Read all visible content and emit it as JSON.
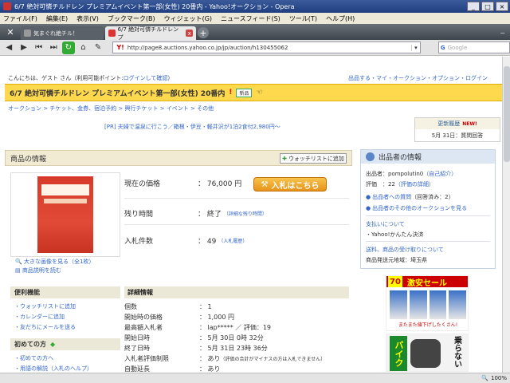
{
  "window": {
    "title": "6/7 絶対可憐チルドレン プレミアムイベント第一部(女性) 20番内 - Yahoo!オークション - Opera",
    "controls": [
      "_",
      "□",
      "×"
    ]
  },
  "menu": [
    "ファイル(F)",
    "編集(E)",
    "表示(V)",
    "ブックマーク(B)",
    "ウィジェット(G)",
    "ニュースフィード(S)",
    "ツール(T)",
    "ヘルプ(H)"
  ],
  "tabs": [
    {
      "label": "気まぐれ絶チル！"
    },
    {
      "label": "6/7 絶対可憐チルドレン プ"
    }
  ],
  "tab_close": "x",
  "new_tab": "+",
  "tabbar_right": "−",
  "address": {
    "logo": "Y!",
    "url": "http://page8.auctions.yahoo.co.jp/jp/auction/h130455062",
    "dropdown": "▾"
  },
  "search": {
    "engine": "G",
    "placeholder": "Google"
  },
  "status": {
    "zoom": "100%"
  },
  "page": {
    "greeting_prefix": "こんにちは、ゲスト さん",
    "greeting_points": "（利用可能ポイント:",
    "login_link": "ログインして確認",
    "greeting_suffix": "）",
    "top_links": "出品する・マイ・オークション・オプション・ログイン",
    "auction_title": "6/7 絶対可憐チルドレン プレミアムイベント第一部(女性) 20番内",
    "badge_new": "新品",
    "breadcrumb": "オークション > チケット、金券、宿泊予約 > 興行チケット > イベント > その他",
    "ad_link": "[PR] 夫婦で温泉に行こう／箱根・伊豆・軽井沢が1泊2食付2,980円〜",
    "history": {
      "title": "更新履歴",
      "new": "NEW!",
      "item": "5月 31日：質問回答"
    },
    "product_box": "商品の情報",
    "watch_button": "ウォッチリストに追加",
    "photo_links": [
      "大きな画像を見る（全1枚）",
      "商品説明を読む"
    ],
    "price": {
      "label": "現在の価格",
      "value": "：  76,000 円",
      "bid_button": "入札はこちら"
    },
    "time": {
      "label": "残り時間",
      "value": "：  終了",
      "sub": "（詳細な残り時間）"
    },
    "bids": {
      "label": "入札件数",
      "value": "：  49",
      "sub": "（入札履歴）"
    },
    "convenient": {
      "title": "便利機能",
      "items": [
        "ウォッチリストに追加",
        "カレンダーに追加",
        "友だちにメールを送る"
      ]
    },
    "beginner": {
      "title": "初めての方",
      "items": [
        "初めての方へ",
        "用語の解説（入札のヘルプ）"
      ]
    },
    "details": {
      "title": "詳細情報",
      "rows": [
        {
          "label": "個数",
          "value": "：  1"
        },
        {
          "label": "開始時の価格",
          "value": "：  1,000 円"
        },
        {
          "label": "最高額入札者",
          "value": "：  lap***** ／ 評価：19"
        },
        {
          "label": "開始日時",
          "value": "：  5月 30日 0時 32分"
        },
        {
          "label": "終了日時",
          "value": "：  5月 31日 23時 36分"
        },
        {
          "label": "入札者評価制限",
          "value": "：  あり",
          "note": "（評価の合計がマイナスの方は入札できません）"
        },
        {
          "label": "自動延長",
          "value": "：  あり"
        }
      ]
    },
    "seller": {
      "title": "出品者の情報",
      "name_label": "出品者：pompolutin0",
      "self_intro": "（自己紹介）",
      "rating_label": "評価　：22",
      "rating_detail": "（評価の詳細）",
      "question_link": "出品者への質問",
      "question_count": "（回答済み：2）",
      "other_link": "出品者のその他のオークションを見る",
      "payment_link": "支払いについて",
      "payment_item": "・Yahoo!かんたん決済",
      "shipping_link": "送料、商品の受け取りについて",
      "shipping_item": "商品発送元地域：埼玉県"
    },
    "ads": {
      "ad1_number": "70",
      "ad1_title": "激安セール",
      "ad1_bottom": "またまた値下げしたくさん!",
      "ad2_left": "バイク",
      "ad2_right": "乗らない"
    }
  }
}
